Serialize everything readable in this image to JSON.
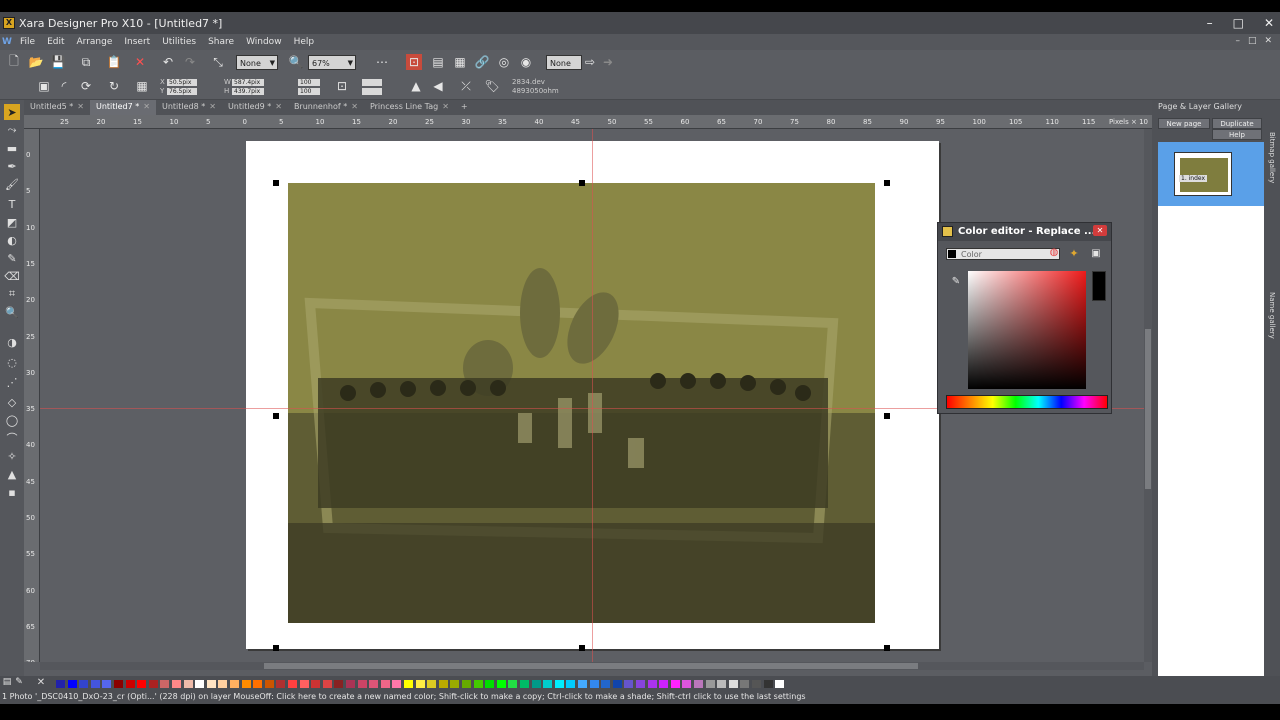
{
  "window": {
    "title": "Xara Designer Pro X10 - [Untitled7 *]",
    "app_icon": "X",
    "controls": [
      "–",
      "□",
      "✕"
    ]
  },
  "menu": {
    "items": [
      "File",
      "Edit",
      "Arrange",
      "Insert",
      "Utilities",
      "Share",
      "Window",
      "Help"
    ],
    "mdi_controls": [
      "–",
      "□",
      "✕"
    ]
  },
  "toolbar1": {
    "quality_dropdown": "None",
    "zoom_dropdown": "67%",
    "name_field": "None"
  },
  "toolbar2": {
    "x_field": "50.5pix",
    "y_field": "76.5pix",
    "w_field": "587.4pix",
    "h_field": "439.7pix",
    "scale_w": "100",
    "scale_h": "100",
    "x_label": "X",
    "y_label": "Y",
    "w_label": "W",
    "h_label": "H",
    "extra1": "2834.dev",
    "extra2": "4893050ohm"
  },
  "doc_tabs": [
    {
      "label": "Untitled5 *",
      "active": false
    },
    {
      "label": "Untitled7 *",
      "active": true
    },
    {
      "label": "Untitled8 *",
      "active": false
    },
    {
      "label": "Untitled9 *",
      "active": false
    },
    {
      "label": "Brunnenhof *",
      "active": false
    },
    {
      "label": "Princess Line Tag",
      "active": false
    }
  ],
  "ruler": {
    "h_ticks": [
      "25",
      "20",
      "15",
      "10",
      "5",
      "0",
      "5",
      "10",
      "15",
      "20",
      "25",
      "30",
      "35",
      "40",
      "45",
      "50",
      "55",
      "60",
      "65",
      "70",
      "75",
      "80",
      "85",
      "90",
      "95",
      "100",
      "105",
      "110",
      "115"
    ],
    "v_ticks": [
      "0",
      "5",
      "10",
      "15",
      "20",
      "25",
      "30",
      "35",
      "40",
      "45",
      "50",
      "55",
      "60",
      "65",
      "70"
    ],
    "units": "Pixels × 10"
  },
  "gallery": {
    "title": "Page & Layer Gallery",
    "new_page": "New page",
    "duplicate": "Duplicate",
    "help": "Help",
    "page_label": "1. index"
  },
  "side_tabs": [
    "Bitmap gallery",
    "Name gallery"
  ],
  "color_editor": {
    "title": "Color editor - Replace ...",
    "color_name": "Color",
    "close": "✕"
  },
  "palette": {
    "colors": [
      "#2222aa",
      "#0000ff",
      "#3344cc",
      "#4455dd",
      "#5566ee",
      "#8b0000",
      "#cc0000",
      "#ff0000",
      "#aa2222",
      "#cc6666",
      "#ff8888",
      "#eebbaa",
      "#ffffff",
      "#ffe4c4",
      "#ffd0a0",
      "#ffb060",
      "#ff8c00",
      "#ff7000",
      "#cc5500",
      "#b03030",
      "#ff4040",
      "#ff6060",
      "#cc3333",
      "#dd4444",
      "#882222",
      "#aa3355",
      "#cc4466",
      "#dd5577",
      "#ee6688",
      "#ff77aa",
      "#ffff00",
      "#ffee44",
      "#ddcc22",
      "#bbaa00",
      "#99aa00",
      "#66aa00",
      "#44cc00",
      "#00dd00",
      "#00ff00",
      "#22dd44",
      "#00bb66",
      "#009988",
      "#00cccc",
      "#00eeff",
      "#00ccff",
      "#44aaff",
      "#3388ee",
      "#2266cc",
      "#1144aa",
      "#6655cc",
      "#8844dd",
      "#aa33ee",
      "#cc22ff",
      "#ff22ff",
      "#dd55dd",
      "#bb77bb",
      "#999999",
      "#bbbbbb",
      "#dddddd",
      "#777777",
      "#555555",
      "#333333",
      "#ffffff"
    ]
  },
  "status": {
    "text": "1 Photo '_DSC0410_DxO-23_cr (Opti...' (228 dpi) on layer MouseOff: Click here to create a new named color; Shift-click to make a copy; Ctrl-click to make a shade; Shift-ctrl click to use the last settings"
  },
  "accent": "#5aa0e8",
  "photo_tint": "#8e8b46"
}
